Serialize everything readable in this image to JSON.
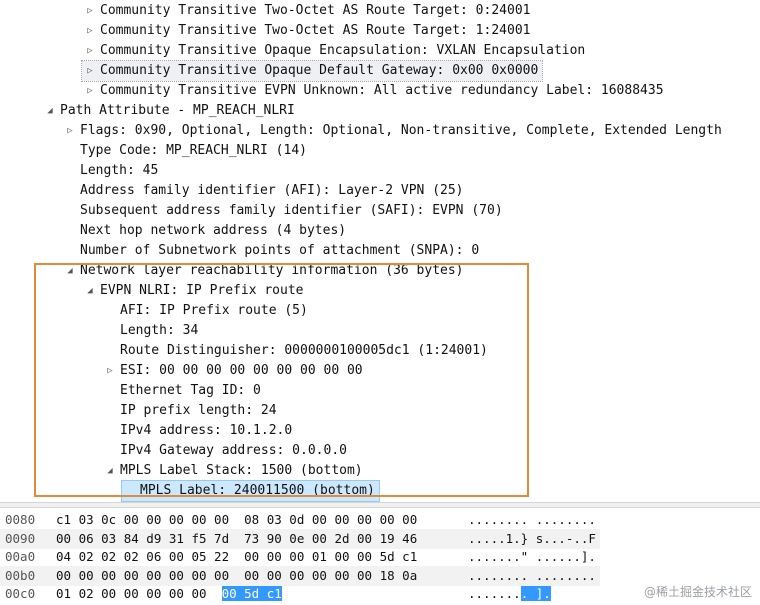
{
  "tree": [
    {
      "indent": 3,
      "toggle": "collapsed",
      "text": "Community Transitive Two-Octet AS Route Target: 0:24001"
    },
    {
      "indent": 3,
      "toggle": "collapsed",
      "text": "Community Transitive Two-Octet AS Route Target: 1:24001"
    },
    {
      "indent": 3,
      "toggle": "collapsed",
      "text": "Community Transitive Opaque Encapsulation: VXLAN Encapsulation"
    },
    {
      "indent": 3,
      "toggle": "collapsed",
      "text": "Community Transitive Opaque Default Gateway: 0x00 0x0000",
      "state": "selected"
    },
    {
      "indent": 3,
      "toggle": "collapsed",
      "text": "Community Transitive EVPN Unknown: All active redundancy Label: 16088435"
    },
    {
      "indent": 1,
      "toggle": "expanded",
      "text": "Path Attribute - MP_REACH_NLRI"
    },
    {
      "indent": 2,
      "toggle": "collapsed",
      "text": "Flags: 0x90, Optional, Length: Optional, Non-transitive, Complete, Extended Length"
    },
    {
      "indent": 2,
      "toggle": "none",
      "text": "Type Code: MP_REACH_NLRI (14)"
    },
    {
      "indent": 2,
      "toggle": "none",
      "text": "Length: 45"
    },
    {
      "indent": 2,
      "toggle": "none",
      "text": "Address family identifier (AFI): Layer-2 VPN (25)"
    },
    {
      "indent": 2,
      "toggle": "none",
      "text": "Subsequent address family identifier (SAFI): EVPN (70)"
    },
    {
      "indent": 2,
      "toggle": "none",
      "text": "Next hop network address (4 bytes)"
    },
    {
      "indent": 2,
      "toggle": "none",
      "text": "Number of Subnetwork points of attachment (SNPA): 0"
    },
    {
      "indent": 2,
      "toggle": "expanded",
      "text": "Network layer reachability information (36 bytes)"
    },
    {
      "indent": 3,
      "toggle": "expanded",
      "text": "EVPN NLRI: IP Prefix route"
    },
    {
      "indent": 4,
      "toggle": "none",
      "text": "AFI: IP Prefix route (5)"
    },
    {
      "indent": 4,
      "toggle": "none",
      "text": "Length: 34"
    },
    {
      "indent": 4,
      "toggle": "none",
      "text": "Route Distinguisher: 0000000100005dc1 (1:24001)"
    },
    {
      "indent": 4,
      "toggle": "collapsed",
      "text": "ESI: 00 00 00 00 00 00 00 00 00"
    },
    {
      "indent": 4,
      "toggle": "none",
      "text": "Ethernet Tag ID: 0"
    },
    {
      "indent": 4,
      "toggle": "none",
      "text": "IP prefix length: 24"
    },
    {
      "indent": 4,
      "toggle": "none",
      "text": "IPv4 address: 10.1.2.0"
    },
    {
      "indent": 4,
      "toggle": "none",
      "text": "IPv4 Gateway address: 0.0.0.0"
    },
    {
      "indent": 4,
      "toggle": "expanded",
      "text": "MPLS Label Stack: 1500 (bottom)"
    },
    {
      "indent": 5,
      "toggle": "none",
      "text": "MPLS Label: 240011500 (bottom)",
      "state": "selected-focus"
    }
  ],
  "hex": [
    {
      "offset": "0080",
      "bytes": "c1 03 0c 00 00 00 00 00  08 03 0d 00 00 00 00 00",
      "ascii": "........ ........"
    },
    {
      "offset": "0090",
      "bytes": "00 06 03 84 d9 31 f5 7d  73 90 0e 00 2d 00 19 46",
      "ascii": ".....1.} s...-..F"
    },
    {
      "offset": "00a0",
      "bytes": "04 02 02 02 06 00 05 22  00 00 00 01 00 00 5d c1",
      "ascii": ".......\" ......]."
    },
    {
      "offset": "00b0",
      "bytes": "00 00 00 00 00 00 00 00  00 00 00 00 00 00 18 0a",
      "ascii": "........ ........"
    },
    {
      "offset": "00c0",
      "bytes_pre": "01 02 00 00 00 00 00 ",
      "bytes_sel": "00 5d c1",
      "ascii_pre": ".......",
      "ascii_sel": ". ]."
    }
  ],
  "watermark": "@稀土掘金技术社区"
}
